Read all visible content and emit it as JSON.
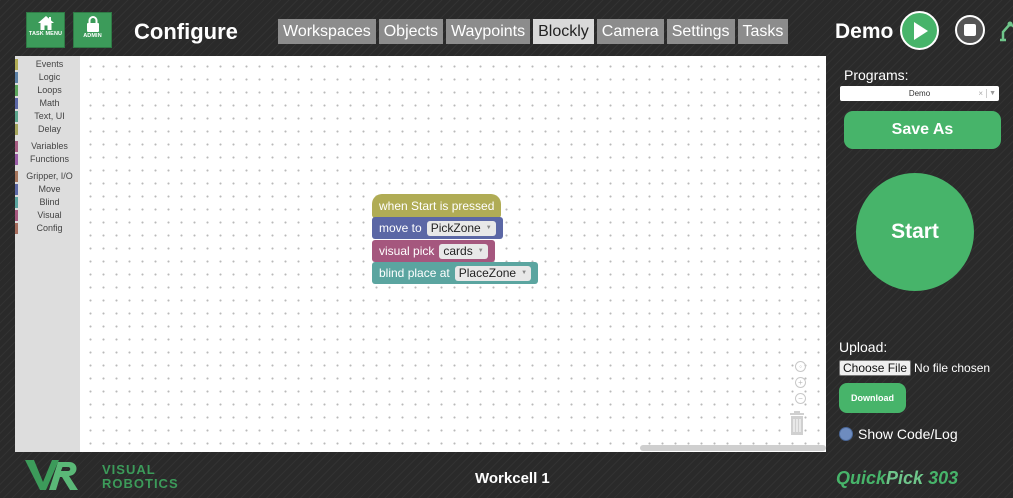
{
  "header": {
    "task_menu_caption": "TASK MENU",
    "admin_caption": "ADMIN",
    "title": "Configure",
    "tabs": [
      {
        "label": "Workspaces",
        "active": false
      },
      {
        "label": "Objects",
        "active": false
      },
      {
        "label": "Waypoints",
        "active": false
      },
      {
        "label": "Blockly",
        "active": true
      },
      {
        "label": "Camera",
        "active": false
      },
      {
        "label": "Settings",
        "active": false
      },
      {
        "label": "Tasks",
        "active": false
      }
    ],
    "program_name": "Demo"
  },
  "toolbox": {
    "categories": [
      {
        "label": "Events",
        "color": "#b0ac55"
      },
      {
        "label": "Logic",
        "color": "#5b80a5"
      },
      {
        "label": "Loops",
        "color": "#5ba55b"
      },
      {
        "label": "Math",
        "color": "#5b67a5"
      },
      {
        "label": "Text, UI",
        "color": "#5ba58c"
      },
      {
        "label": "Delay",
        "color": "#a5a55b"
      },
      {
        "label": "Variables",
        "color": "#a55b80"
      },
      {
        "label": "Functions",
        "color": "#995ba5"
      },
      {
        "label": "Gripper, I/O",
        "color": "#a5745b"
      },
      {
        "label": "Move",
        "color": "#5b67a5"
      },
      {
        "label": "Blind",
        "color": "#5ba5a0"
      },
      {
        "label": "Visual",
        "color": "#a5577e"
      },
      {
        "label": "Config",
        "color": "#a56b5b"
      }
    ]
  },
  "blocks": {
    "start_label": "when Start is pressed",
    "move_label": "move to",
    "move_field": "PickZone",
    "pick_label": "visual pick",
    "pick_field": "cards",
    "place_label": "blind place at",
    "place_field": "PlaceZone"
  },
  "sidebar": {
    "programs_label": "Programs:",
    "selected_program": "Demo",
    "save_as_label": "Save As",
    "start_label": "Start",
    "upload_label": "Upload:",
    "choose_file_label": "Choose File",
    "no_file_text": "No file chosen",
    "download_label": "Download",
    "show_code_label": "Show Code/Log"
  },
  "footer": {
    "logo_line1": "VISUAL",
    "logo_line2": "ROBOTICS",
    "workcell": "Workcell 1",
    "product_quick": "Quick",
    "product_pick": "Pick",
    "product_model": " 303"
  },
  "colors": {
    "accent_green": "#47b46a",
    "tab_active": "#d9d9d9",
    "tab_inactive": "#8c8c8c"
  }
}
